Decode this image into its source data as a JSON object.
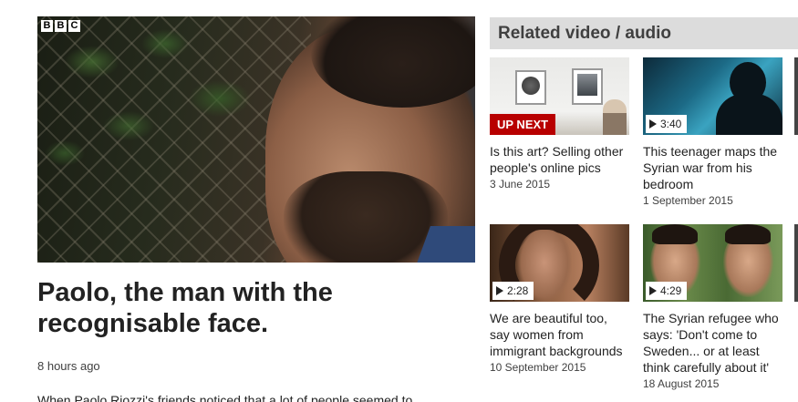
{
  "player": {
    "logo_letters": [
      "B",
      "B",
      "C"
    ]
  },
  "story": {
    "title": "Paolo, the man with the recognisable face.",
    "timestamp": "8 hours ago",
    "intro": "When Paolo Riozzi's friends noticed that a lot of people seemed to"
  },
  "related": {
    "heading": "Related video / audio",
    "items": [
      {
        "badge": "UP NEXT",
        "title": "Is this art? Selling other people's online pics",
        "date": "3 June 2015",
        "icon": "play-icon"
      },
      {
        "duration": "3:40",
        "title": "This teenager maps the Syrian war from his bedroom",
        "date": "1 September 2015",
        "icon": "play-icon"
      },
      {
        "duration": "2:28",
        "title": "We are beautiful too, say women from immigrant backgrounds",
        "date": "10 September 2015",
        "icon": "play-icon"
      },
      {
        "duration": "4:29",
        "title": "The Syrian refugee who says: 'Don't come to Sweden... or at least think carefully about it'",
        "date": "18 August 2015",
        "icon": "play-icon"
      }
    ]
  },
  "colors": {
    "up_next_red": "#b80000",
    "header_grey": "#dcdcdc",
    "text": "#222222",
    "muted_text": "#404040"
  }
}
